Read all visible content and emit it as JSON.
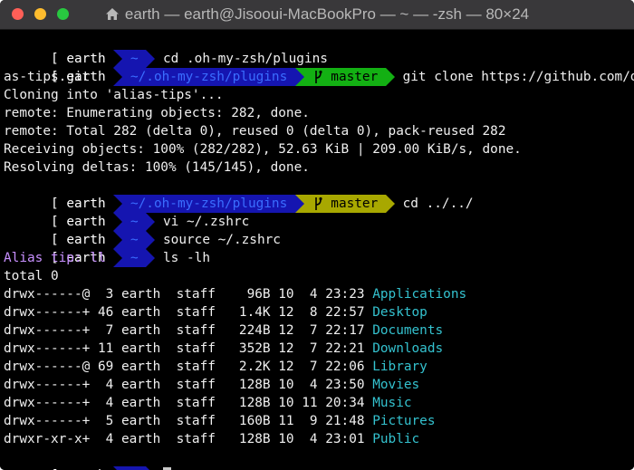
{
  "window": {
    "title": "earth — earth@Jisooui-MacBookPro — ~ — -zsh — 80×24",
    "buttons": [
      "close",
      "minimize",
      "maximize"
    ],
    "title_icon": "home-icon"
  },
  "colors": {
    "background": "#000000",
    "text": "#f0f0f0",
    "dir_segment_bg": "#1515b0",
    "dir_segment_fg": "#3a6dff",
    "git_clean_bg": "#13b013",
    "git_dirty_bg": "#a8a800",
    "alias_tip": "#c890ff",
    "directory_name": "#34c2cf"
  },
  "prompt": {
    "user": "earth",
    "home_dir": "~",
    "plugins_dir": "~/.oh-my-zsh/plugins",
    "branch": "master"
  },
  "lines": {
    "l1_cmd": "cd .oh-my-zsh/plugins",
    "l2_cmd": "git clone https://github.com/djui/ali",
    "l3": "as-tips.git",
    "l4": "Cloning into 'alias-tips'...",
    "l5": "remote: Enumerating objects: 282, done.",
    "l6": "remote: Total 282 (delta 0), reused 0 (delta 0), pack-reused 282",
    "l7": "Receiving objects: 100% (282/282), 52.63 KiB | 209.00 KiB/s, done.",
    "l8": "Resolving deltas: 100% (145/145), done.",
    "l9_cmd": "cd ../../",
    "l10_cmd": "vi ~/.zshrc",
    "l11_cmd": "source ~/.zshrc",
    "l12_cmd": "ls -lh",
    "alias_tip": "Alias tip: ll",
    "total": "total 0"
  },
  "listing": [
    {
      "meta": "drwx------@  3 earth  staff    96B 10  4 23:23 ",
      "name": "Applications"
    },
    {
      "meta": "drwx------+ 46 earth  staff   1.4K 12  8 22:57 ",
      "name": "Desktop"
    },
    {
      "meta": "drwx------+  7 earth  staff   224B 12  7 22:17 ",
      "name": "Documents"
    },
    {
      "meta": "drwx------+ 11 earth  staff   352B 12  7 22:21 ",
      "name": "Downloads"
    },
    {
      "meta": "drwx------@ 69 earth  staff   2.2K 12  7 22:06 ",
      "name": "Library"
    },
    {
      "meta": "drwx------+  4 earth  staff   128B 10  4 23:50 ",
      "name": "Movies"
    },
    {
      "meta": "drwx------+  4 earth  staff   128B 10 11 20:34 ",
      "name": "Music"
    },
    {
      "meta": "drwx------+  5 earth  staff   160B 11  9 21:48 ",
      "name": "Pictures"
    },
    {
      "meta": "drwxr-xr-x+  4 earth  staff   128B 10  4 23:01 ",
      "name": "Public"
    }
  ]
}
